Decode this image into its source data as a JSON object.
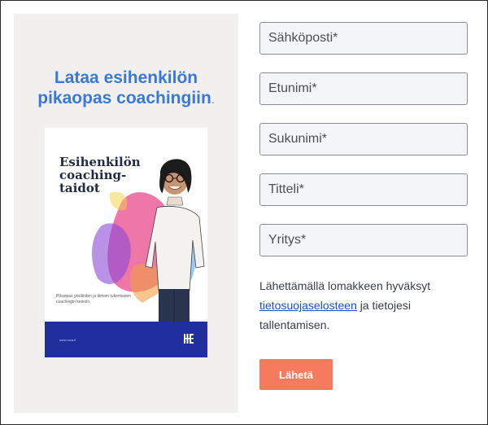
{
  "promo": {
    "headline_line1": "Lataa esihenkilön",
    "headline_line2": "pikaopas coachingiin",
    "headline_dot": ".",
    "book": {
      "title": "Esihenkilön coaching-taidot",
      "subtitle": "Pikaopas yksilöiden ja tiimien tukemiseen coachingin keinoin.",
      "url": "www.mca.fi",
      "footer_color": "#1f2f9e",
      "logo_icon": "brand-logo-icon"
    }
  },
  "form": {
    "fields": {
      "email_placeholder": "Sähköposti*",
      "firstname_placeholder": "Etunimi*",
      "lastname_placeholder": "Sukunimi*",
      "title_placeholder": "Titteli*",
      "company_placeholder": "Yritys*"
    },
    "consent": {
      "before": "Lähettämällä lomakkeen hyväksyt ",
      "link": "tietosuojaselosteen",
      "after": " ja tietojesi tallentamisen."
    },
    "submit_label": "Lähetä"
  },
  "colors": {
    "accent_blue": "#3a78d8",
    "submit": "#f57a5e",
    "link": "#1a4fd8"
  }
}
